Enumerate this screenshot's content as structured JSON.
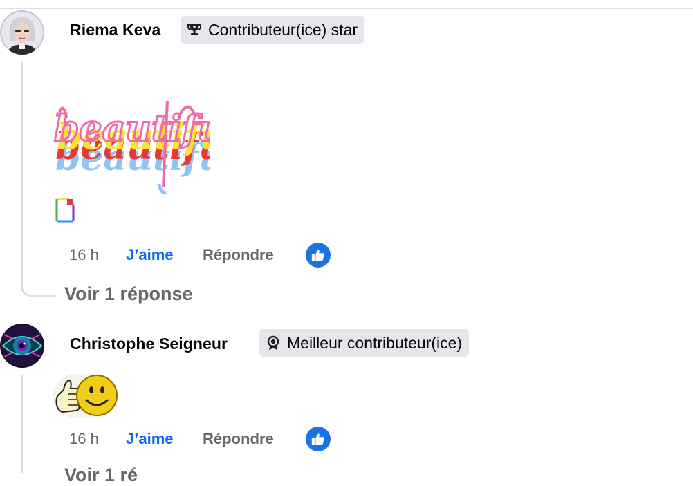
{
  "comments": [
    {
      "author": "Riema Keva",
      "badge": "Contributeur(ice) star",
      "badge_icon": "trophy-icon",
      "sticker": {
        "word": "beautiful",
        "layer_colors": [
          "#8ec5f5",
          "#e53935",
          "#ffe033",
          "#f06aa8"
        ]
      },
      "attachment_icon": "broken-image-icon",
      "time": "16 h",
      "like_label": "J’aime",
      "reply_label": "Répondre",
      "reaction_icon": "like-reaction-icon",
      "see_replies": "Voir 1 réponse"
    },
    {
      "author": "Christophe Seigneur",
      "badge": "Meilleur contributeur(ice)",
      "badge_icon": "award-icon",
      "sticker": {
        "name": "thumbs-up-smiley"
      },
      "time": "16 h",
      "like_label": "J’aime",
      "reply_label": "Répondre",
      "reaction_icon": "like-reaction-icon",
      "see_replies_partial": "Voir 1 ré"
    }
  ],
  "colors": {
    "link_blue": "#0866ff",
    "meta_gray": "#65676b",
    "badge_bg": "#e4e6eb",
    "reaction_blue": "#1b74e4"
  }
}
